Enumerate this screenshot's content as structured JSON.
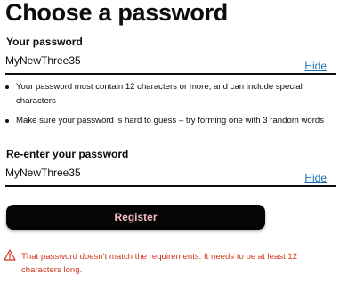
{
  "page": {
    "title": "Choose a password"
  },
  "password_field": {
    "label": "Your password",
    "value": "MyNewThree35",
    "toggle_label": "Hide"
  },
  "hints": [
    "Your password must contain 12 characters or more, and can include special characters",
    "Make sure your password is hard to guess – try forming one with 3 random words"
  ],
  "confirm_field": {
    "label": "Re-enter your password",
    "value": "MyNewThree35",
    "toggle_label": "Hide"
  },
  "register_button": {
    "label": "Register"
  },
  "error": {
    "icon": "warning-triangle-icon",
    "message": "That password doesn't match the requirements. It needs to be at least 12 characters long."
  },
  "colors": {
    "text": "#0b0c0c",
    "link": "#1d70b8",
    "error": "#d4351c",
    "button_background": "#050505",
    "button_text": "#f3bcc1"
  }
}
